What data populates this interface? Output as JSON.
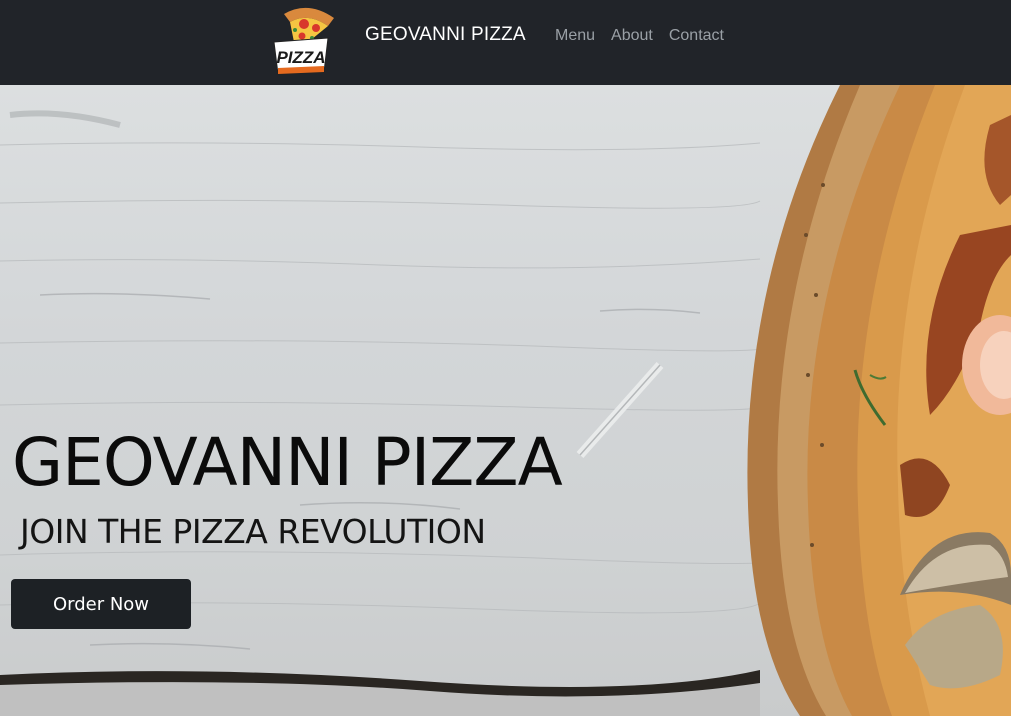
{
  "navbar": {
    "logo_text": "PIZZA",
    "brand": "GEOVANNI PIZZA",
    "links": [
      {
        "label": "Menu"
      },
      {
        "label": "About"
      },
      {
        "label": "Contact"
      }
    ]
  },
  "hero": {
    "title": "GEOVANNI PIZZA",
    "subtitle": "JOIN THE PIZZA REVOLUTION",
    "cta_label": "Order Now"
  },
  "colors": {
    "navbar_bg": "#212429",
    "nav_link": "#9aa0a6",
    "button_bg": "#1d2125",
    "wood_bg": "#d6d9da"
  },
  "icons": {
    "logo": "pizza-slice-logo-icon"
  }
}
